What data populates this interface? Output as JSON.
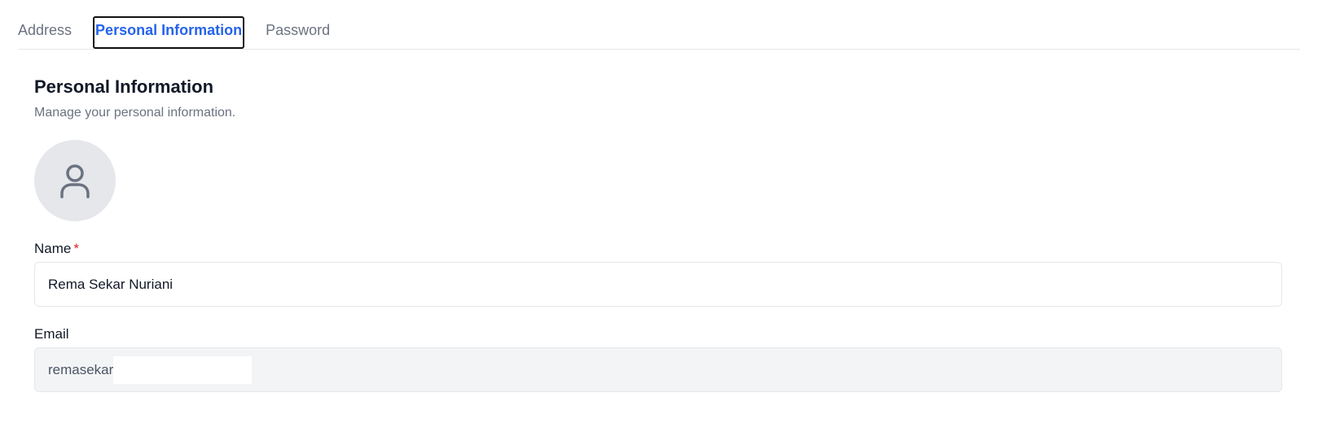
{
  "tabs": [
    {
      "label": "Address",
      "active": false
    },
    {
      "label": "Personal Information",
      "active": true
    },
    {
      "label": "Password",
      "active": false
    }
  ],
  "section": {
    "title": "Personal Information",
    "subtitle": "Manage your personal information."
  },
  "avatar": {
    "icon": "user-icon"
  },
  "name_field": {
    "label": "Name",
    "required_mark": "*",
    "value": "Rema Sekar Nuriani"
  },
  "email_field": {
    "label": "Email",
    "value": "remasekar"
  },
  "colors": {
    "accent": "#2563eb",
    "required": "#dc2626",
    "muted_text": "#6b7280",
    "disabled_bg": "#f3f4f6",
    "border": "#e5e7eb"
  }
}
